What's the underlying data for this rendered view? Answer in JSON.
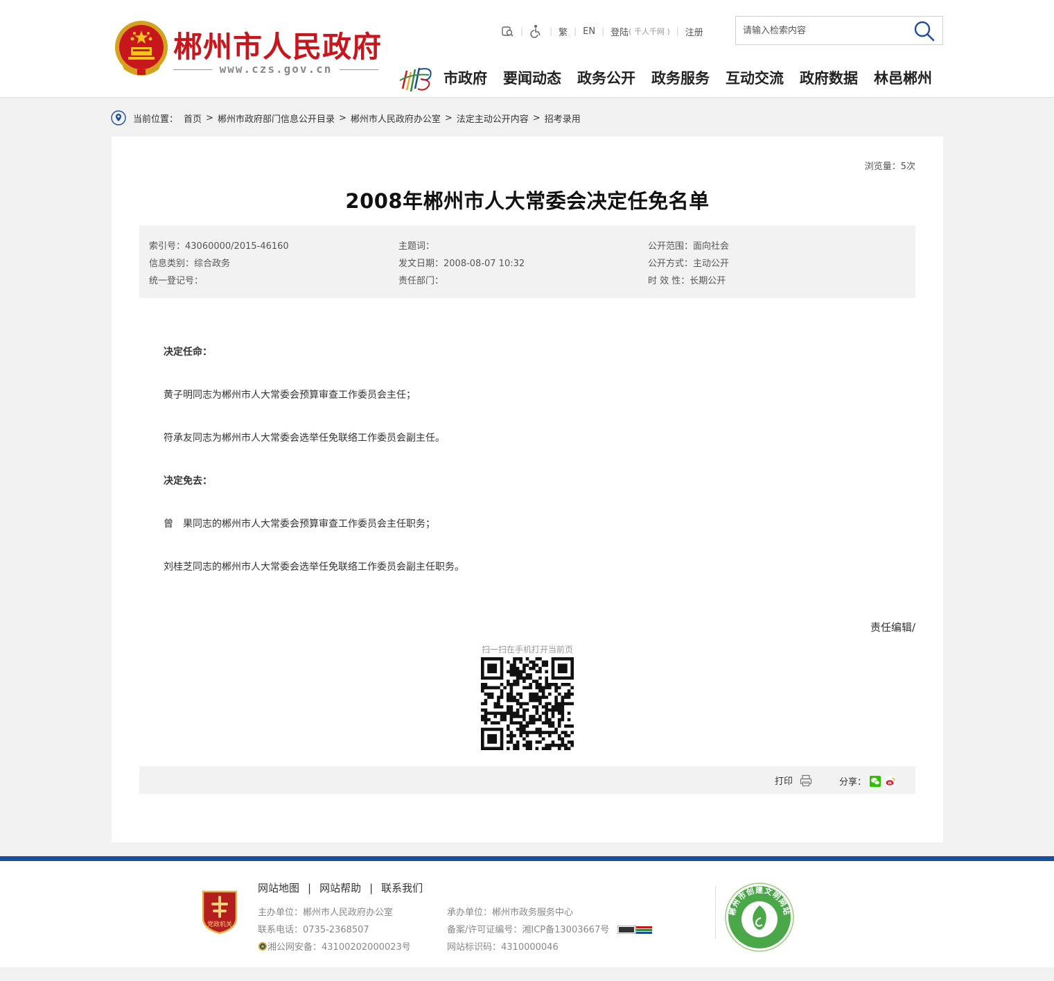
{
  "header": {
    "site_name": "郴州市人民政府",
    "site_url": "www.czs.gov.cn",
    "toplinks": {
      "traditional": "繁",
      "english": "EN",
      "login": "登陆",
      "login_sub": "( 千人千网 )",
      "register": "注册"
    },
    "search_placeholder": "请输入检索内容",
    "nav": [
      "市政府",
      "要闻动态",
      "政务公开",
      "政务服务",
      "互动交流",
      "政府数据",
      "林邑郴州"
    ]
  },
  "breadcrumb": {
    "label": "当前位置：",
    "items": [
      "首页",
      "郴州市政府部门信息公开目录",
      "郴州市人民政府办公室",
      "法定主动公开内容",
      "招考录用"
    ]
  },
  "article": {
    "views": "浏览量：5次",
    "title": "2008年郴州市人大常委会决定任免名单",
    "meta": {
      "index_no": "索引号：43060000/2015-46160",
      "subject": "主题词：",
      "scope": "公开范围：面向社会",
      "category": "信息类别：综合政务",
      "date": "发文日期：2008-08-07 10:32",
      "method": "公开方式：主动公开",
      "reg_no": "统一登记号：",
      "dept": "责任部门：",
      "validity": "时 效 性：长期公开"
    },
    "paragraphs": [
      "决定任命：",
      "黄子明同志为郴州市人大常委会预算审查工作委员会主任；",
      "符承友同志为郴州市人大常委会选举任免联络工作委员会副主任。",
      "决定免去：",
      "曾　果同志的郴州市人大常委会预算审查工作委员会主任职务；",
      "刘桂芝同志的郴州市人大常委会选举任免联络工作委员会副主任职务。"
    ],
    "editor": "责任编辑/",
    "qr_caption": "扫一扫在手机打开当前页",
    "print_label": "打印",
    "share_label": "分享："
  },
  "footer": {
    "links": [
      "网站地图",
      "网站帮助",
      "联系我们"
    ],
    "host": "主办单位：郴州市人民政府办公室",
    "phone": "联系电话：0735-2368507",
    "police": "湘公网安备：43100202000023号",
    "organizer": "承办单位：郴州市政务服务中心",
    "icp": "备案/许可证编号：湘ICP备13003667号",
    "site_code": "网站标识码：4310000046",
    "party_badge_text": "党政机关",
    "civil_badge_text": "郴州市创建文明网站"
  }
}
